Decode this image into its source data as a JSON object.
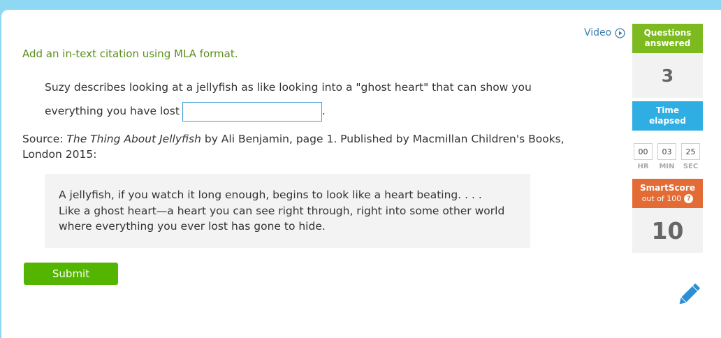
{
  "prompt": "Add an in-text citation using MLA format.",
  "question": {
    "text_before": "Suzy describes looking at a jellyfish as like looking into a \"ghost heart\" that can show you everything you have lost",
    "text_after": ".",
    "answer_value": ""
  },
  "source": {
    "label": "Source:",
    "book_title": "The Thing About Jellyfish",
    "details": "by Ali Benjamin, page 1. Published by Macmillan Children's Books, London 2015:"
  },
  "quote": "A jellyfish, if you watch it long enough, begins to look like a heart beating. . . . Like a ghost heart—a heart you can see right through, right into some other world where everything you ever lost has gone to hide.",
  "submit_label": "Submit",
  "video": {
    "label": "Video",
    "icon": "play-circle-icon"
  },
  "sidebar": {
    "questions_answered_label": "Questions answered",
    "questions_answered_value": "3",
    "time_elapsed_label": "Time elapsed",
    "timer": {
      "hr": "00",
      "min": "03",
      "sec": "25",
      "hr_label": "HR",
      "min_label": "MIN",
      "sec_label": "SEC"
    },
    "smartscore_label": "SmartScore",
    "smartscore_sub": "out of 100",
    "smartscore_value": "10"
  },
  "colors": {
    "background": "#8ed8f4",
    "prompt_green": "#5a8f1c",
    "submit_green": "#54b500",
    "questions_header": "#7cba1f",
    "time_header": "#2eaee2",
    "smartscore_header": "#e26b36",
    "pencil_blue": "#2b8fd6"
  }
}
